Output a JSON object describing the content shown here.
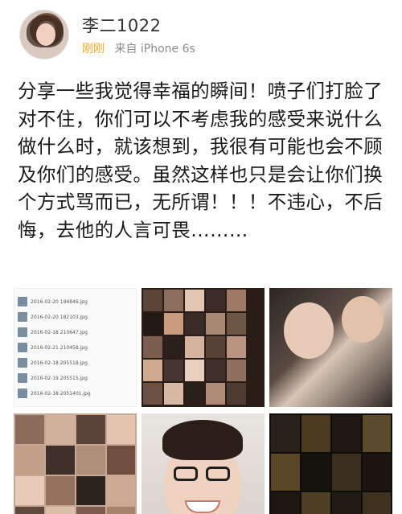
{
  "post": {
    "username": "李二1022",
    "time": "刚刚",
    "source": "来自 iPhone 6s",
    "text": "分享一些我觉得幸福的瞬间！喷子们打脸了对不住，你们可以不考虑我的感受来说什么做什么时，就该想到，我很有可能也会不顾及你们的感受。虽然这样也只是会让你们换个方式骂而已，无所谓！！！不违心，不后悔，去他的人言可畏………"
  },
  "file_list": [
    {
      "name": "2016-02-20 194846.jpg",
      "size": ""
    },
    {
      "name": "2016-02-20 182103.jpg",
      "size": ""
    },
    {
      "name": "2016-02-18 210647.jpg",
      "size": ""
    },
    {
      "name": "2016-02-21 210458.jpg",
      "size": ""
    },
    {
      "name": "2016-02-18 205518.jpg",
      "size": ""
    },
    {
      "name": "2016-02-19 205515.jpg",
      "size": ""
    },
    {
      "name": "2016-02-18 2051401.jpg",
      "size": ""
    }
  ],
  "icons": {
    "avatar": "user-avatar"
  }
}
